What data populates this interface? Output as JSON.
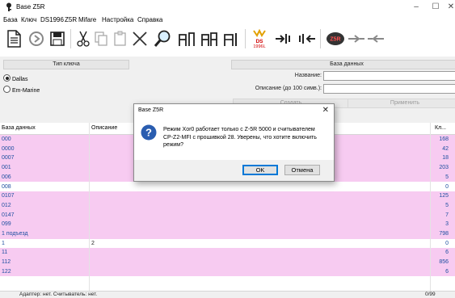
{
  "window": {
    "title": "Base Z5R",
    "controls": [
      "–",
      "☐",
      "✕"
    ]
  },
  "menu": [
    "База",
    "Ключ",
    "DS1996",
    "Z5R",
    "Mifare",
    "Настройка",
    "Справка"
  ],
  "toolbar": {
    "icons": [
      "new-doc-icon",
      "refresh-icon",
      "save-icon",
      "cut-icon",
      "copy-icon",
      "paste-icon",
      "delete-icon",
      "search-icon",
      "add-user-icon",
      "find-user-icon",
      "list-icon",
      "ds1996-icon",
      "key-read-icon",
      "key-write-icon",
      "z5r-icon",
      "arrow-right-icon",
      "arrow-left-icon"
    ],
    "ds_label": "DS\n1996L",
    "z5r_label": "Z5R"
  },
  "key_type": {
    "header": "Тип ключа",
    "options": [
      {
        "label": "Dallas",
        "selected": true
      },
      {
        "label": "Em-Marine",
        "selected": false
      }
    ]
  },
  "database_panel": {
    "header": "База данных",
    "name_label": "Название:",
    "desc_label": "Описание (до 100 симв.):",
    "create_button": "Создать",
    "apply_button": "Применить"
  },
  "table": {
    "columns": [
      "База данных",
      "Описание",
      "Кл..."
    ],
    "rows": [
      {
        "name": "000",
        "desc": "",
        "count": "168",
        "color": "pink"
      },
      {
        "name": "0000",
        "desc": "",
        "count": "42",
        "color": "pink"
      },
      {
        "name": "0007",
        "desc": "",
        "count": "18",
        "color": "pink"
      },
      {
        "name": "001",
        "desc": "",
        "count": "203",
        "color": "pink"
      },
      {
        "name": "006",
        "desc": "",
        "count": "5",
        "color": "pink"
      },
      {
        "name": "008",
        "desc": "",
        "count": "0",
        "color": "white"
      },
      {
        "name": "0107",
        "desc": "",
        "count": "125",
        "color": "pink"
      },
      {
        "name": "012",
        "desc": "",
        "count": "5",
        "color": "pink"
      },
      {
        "name": "0147",
        "desc": "",
        "count": "7",
        "color": "pink"
      },
      {
        "name": "099",
        "desc": "",
        "count": "3",
        "color": "pink"
      },
      {
        "name": "1 подъезд",
        "desc": "",
        "count": "798",
        "color": "pink"
      },
      {
        "name": "1",
        "desc": "2",
        "count": "0",
        "color": "white"
      },
      {
        "name": "11",
        "desc": "",
        "count": "6",
        "color": "pink"
      },
      {
        "name": "112",
        "desc": "",
        "count": "856",
        "color": "pink"
      },
      {
        "name": "122",
        "desc": "",
        "count": "6",
        "color": "pink"
      }
    ]
  },
  "status": {
    "left": "Адаптер: нет. Считыватель: нет.",
    "right": "0/99"
  },
  "dialog": {
    "title": "Base Z5R",
    "close": "✕",
    "message": "Режим Xor0 работает только с Z-5R 5000 и считывателем CP-Z2-MFI с прошивкой 28. Уверены, что хотите включить режим?",
    "ok": "OK",
    "cancel": "Отмена"
  },
  "colors": {
    "row_pink": "#f7cbf1",
    "name_blue": "#1e4fa0",
    "ok_border": "#0078d7"
  }
}
